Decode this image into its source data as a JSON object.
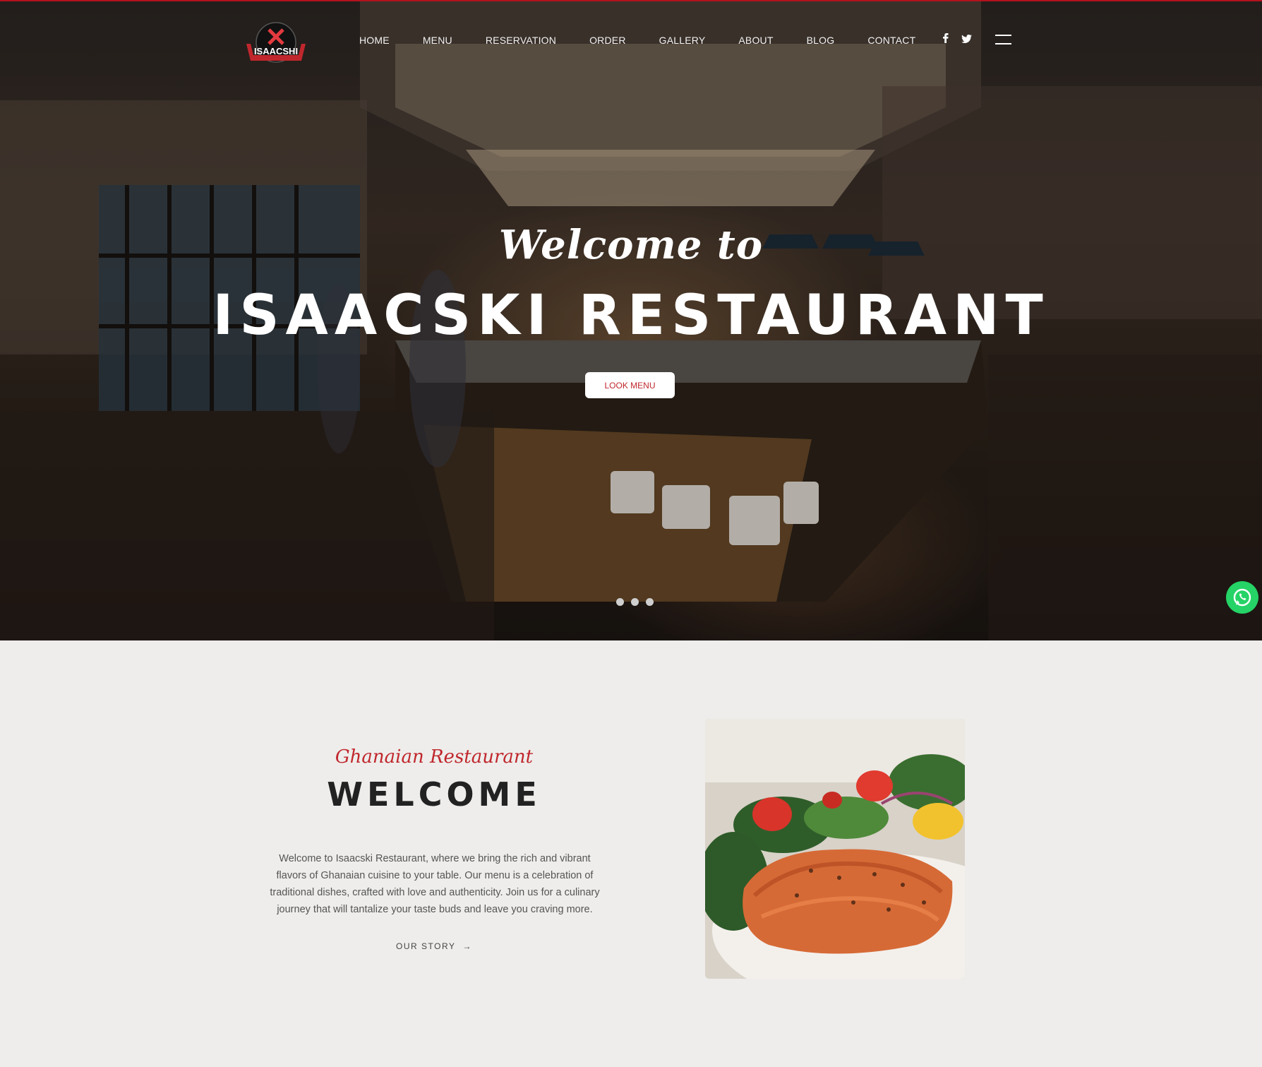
{
  "header": {
    "logo_text": "ISAACSHI",
    "nav": [
      "HOME",
      "MENU",
      "RESERVATION",
      "ORDER",
      "GALLERY",
      "ABOUT",
      "BLOG",
      "CONTACT"
    ],
    "social_icons": [
      "facebook-icon",
      "twitter-icon"
    ],
    "menu_icon": "hamburger-icon"
  },
  "hero": {
    "welcome": "Welcome to",
    "title": "ISAACSKI RESTAURANT",
    "button": "LOOK MENU",
    "slides": 3
  },
  "welcome_section": {
    "subtitle": "Ghanaian Restaurant",
    "heading": "WELCOME",
    "paragraph": "Welcome to Isaacski Restaurant, where we bring the rich and vibrant flavors of Ghanaian cuisine to your table. Our menu is a celebration of traditional dishes, crafted with love and authenticity. Join us for a culinary journey that will tantalize your taste buds and leave you craving more.",
    "link": "OUR STORY",
    "link_arrow": "→"
  },
  "floating": {
    "icon": "whatsapp-icon"
  },
  "colors": {
    "accent": "#c0272d",
    "background": "#eeedeb",
    "whatsapp": "#25d366"
  }
}
